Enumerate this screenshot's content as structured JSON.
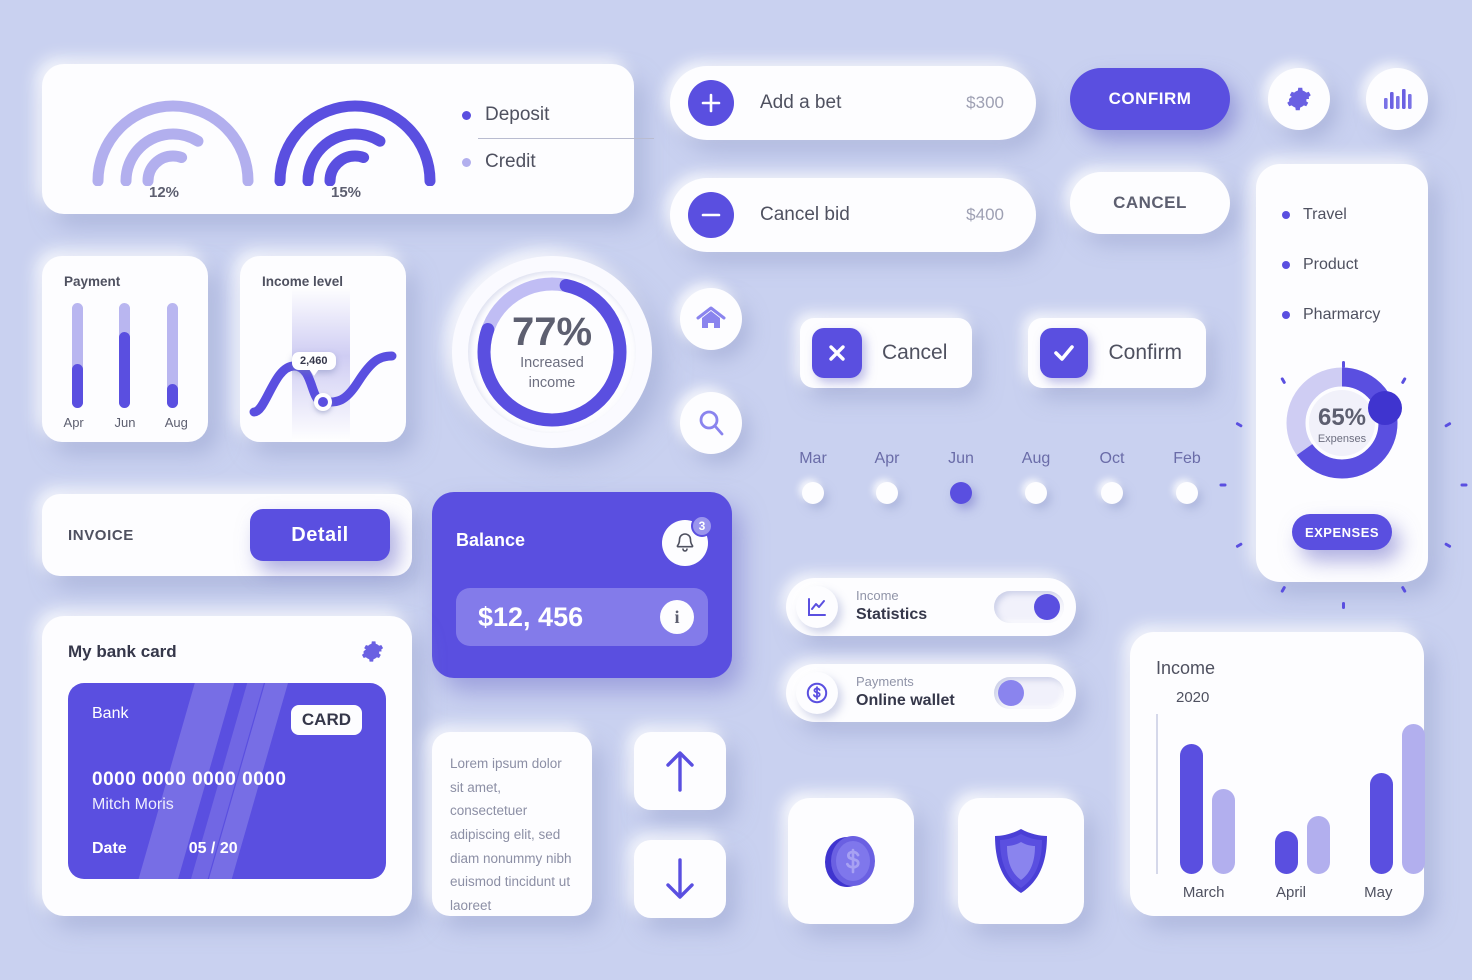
{
  "theme": {
    "background": "#c9d1f0",
    "accent": "#5a4fe0",
    "accent_light": "#b2afee",
    "surface": "#fdfdff",
    "text_dark": "#35374a",
    "text_muted": "#8c8fa5"
  },
  "rainbow_card": {
    "gauges": [
      {
        "percent_label": "12%",
        "value": 12,
        "color": "#b2afee"
      },
      {
        "percent_label": "15%",
        "value": 15,
        "color": "#5a4fe0"
      }
    ],
    "legend": [
      {
        "label": "Deposit",
        "color": "#5a4fe0"
      },
      {
        "label": "Credit",
        "color": "#b2afee"
      }
    ]
  },
  "payment_card": {
    "title": "Payment",
    "bars": [
      {
        "label": "Apr",
        "fill_percent": 42
      },
      {
        "label": "Jun",
        "fill_percent": 72
      },
      {
        "label": "Aug",
        "fill_percent": 23
      }
    ]
  },
  "income_level_card": {
    "title": "Income level",
    "tooltip_value": "2,460"
  },
  "gauge_increased_income": {
    "percent": "77%",
    "value": 77,
    "caption_line1": "Increased",
    "caption_line2": "income"
  },
  "bet_rows": [
    {
      "icon": "plus-icon",
      "label": "Add a bet",
      "amount": "$300"
    },
    {
      "icon": "minus-icon",
      "label": "Cancel bid",
      "amount": "$400"
    }
  ],
  "primary_actions": {
    "confirm_label": "CONFIRM",
    "cancel_label": "CANCEL"
  },
  "icon_buttons": {
    "gear": "gear-icon",
    "bars": "bar-chart-icon",
    "home": "home-icon",
    "search": "search-icon",
    "arrow_up": "arrow-up-icon",
    "arrow_down": "arrow-down-icon"
  },
  "expenses_panel": {
    "categories": [
      {
        "label": "Travel"
      },
      {
        "label": "Product"
      },
      {
        "label": "Pharmarcy"
      }
    ],
    "gauge": {
      "percent": "65%",
      "value": 65,
      "caption": "Expenses"
    },
    "button_label": "EXPENSES"
  },
  "invoice_card": {
    "label": "INVOICE",
    "button_label": "Detail"
  },
  "balance_card": {
    "title": "Balance",
    "notification_count": "3",
    "amount": "$12, 456",
    "info_glyph": "i"
  },
  "bank_card": {
    "title": "My bank card",
    "bank_label": "Bank",
    "chip_label": "CARD",
    "number": "0000 0000 0000 0000",
    "holder": "Mitch Moris",
    "date_label": "Date",
    "date_value": "05 / 20"
  },
  "lorem_card": {
    "text": "Lorem ipsum dolor sit amet, consectetuer adipiscing elit, sed diam nonummy nibh euismod tincidunt ut laoreet"
  },
  "choice_buttons": [
    {
      "label": "Cancel",
      "icon": "close-icon"
    },
    {
      "label": "Confirm",
      "icon": "check-icon"
    }
  ],
  "month_selector": {
    "months": [
      {
        "label": "Mar",
        "selected": false
      },
      {
        "label": "Apr",
        "selected": false
      },
      {
        "label": "Jun",
        "selected": true
      },
      {
        "label": "Aug",
        "selected": false
      },
      {
        "label": "Oct",
        "selected": false
      },
      {
        "label": "Feb",
        "selected": false
      }
    ]
  },
  "toggle_rows": [
    {
      "icon": "line-chart-icon",
      "subtitle": "Income",
      "title": "Statistics",
      "state": "on"
    },
    {
      "icon": "dollar-coin-icon",
      "subtitle": "Payments",
      "title": "Online wallet",
      "state": "off"
    }
  ],
  "tiles": [
    {
      "icon": "coin-icon"
    },
    {
      "icon": "shield-icon"
    }
  ],
  "chart_data": {
    "type": "bar",
    "title": "Income",
    "subtitle": "2020",
    "categories": [
      "March",
      "April",
      "May"
    ],
    "series": [
      {
        "name": "dark",
        "color": "#5a4fe0",
        "values": [
          100,
          33,
          78
        ]
      },
      {
        "name": "light",
        "color": "#b2afee",
        "values": [
          65,
          44,
          115
        ]
      }
    ],
    "xlabel": "",
    "ylabel": "",
    "ylim": [
      0,
      125
    ],
    "grid": false,
    "legend_position": "none"
  }
}
